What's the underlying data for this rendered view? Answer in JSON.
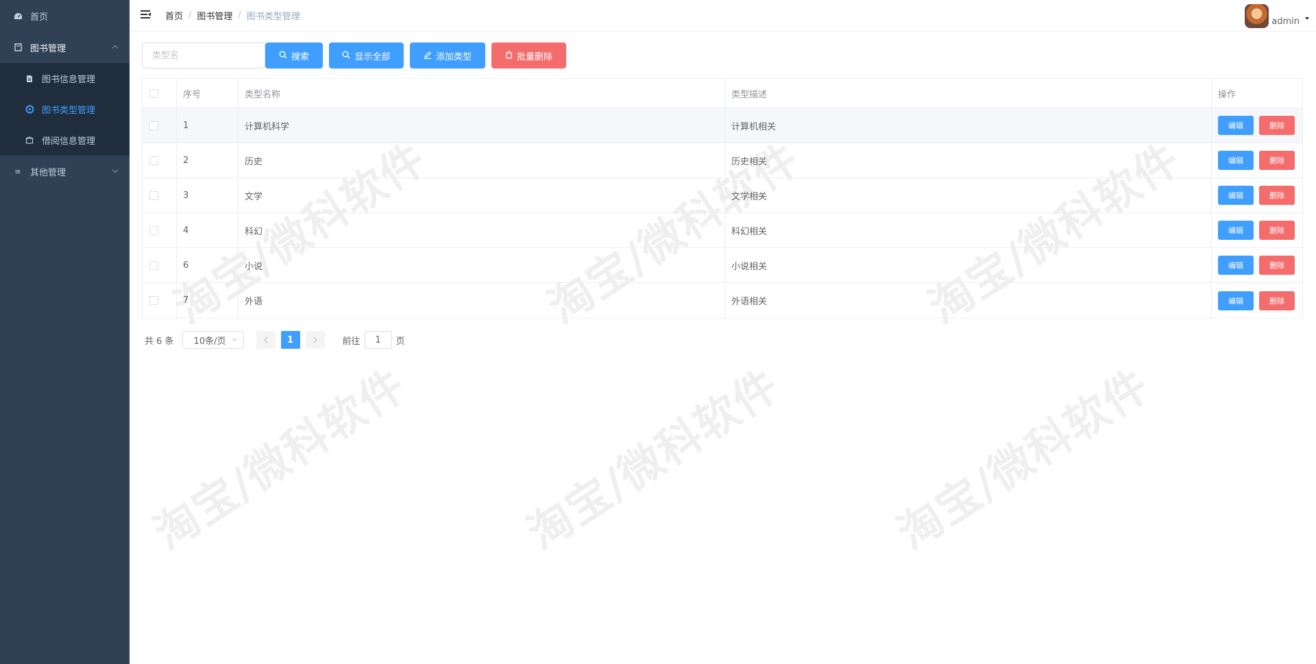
{
  "sidebar": {
    "items": [
      {
        "label": "首页",
        "icon": "dashboard-icon"
      },
      {
        "label": "图书管理",
        "icon": "document-icon",
        "expanded": true,
        "children": [
          {
            "label": "图书信息管理",
            "icon": "file-list-icon",
            "active": false
          },
          {
            "label": "图书类型管理",
            "icon": "category-icon",
            "active": true
          },
          {
            "label": "借阅信息管理",
            "icon": "box-icon",
            "active": false
          }
        ]
      },
      {
        "label": "其他管理",
        "icon": "menu-icon",
        "expanded": false
      }
    ]
  },
  "header": {
    "breadcrumb": [
      "首页",
      "图书管理",
      "图书类型管理"
    ],
    "username": "admin"
  },
  "toolbar": {
    "search_placeholder": "类型名",
    "search_label": "搜索",
    "show_all_label": "显示全部",
    "add_label": "添加类型",
    "batch_delete_label": "批量删除"
  },
  "table": {
    "headers": {
      "index": "序号",
      "name": "类型名称",
      "desc": "类型描述",
      "ops": "操作"
    },
    "rows": [
      {
        "index": "1",
        "name": "计算机科学",
        "desc": "计算机相关"
      },
      {
        "index": "2",
        "name": "历史",
        "desc": "历史相关"
      },
      {
        "index": "3",
        "name": "文学",
        "desc": "文学相关"
      },
      {
        "index": "4",
        "name": "科幻",
        "desc": "科幻相关"
      },
      {
        "index": "6",
        "name": "小说",
        "desc": "小说相关"
      },
      {
        "index": "7",
        "name": "外语",
        "desc": "外语相关"
      }
    ],
    "edit_label": "编辑",
    "delete_label": "删除"
  },
  "pagination": {
    "total_text": "共 6 条",
    "page_size": "10条/页",
    "current_page": "1",
    "goto_label": "前往",
    "goto_value": "1",
    "page_suffix": "页"
  },
  "watermark": "淘宝/微科软件",
  "colors": {
    "primary": "#409eff",
    "danger": "#f56c6c",
    "sidebar": "#304156",
    "submenu": "#1f2d3d"
  }
}
